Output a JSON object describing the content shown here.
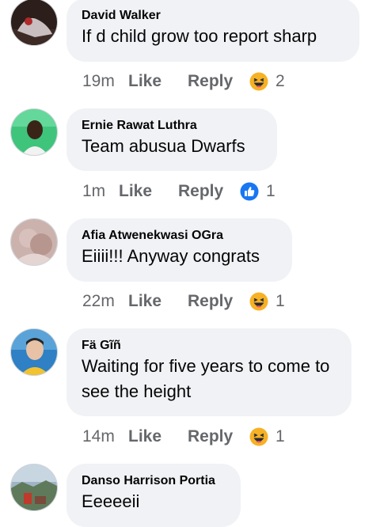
{
  "comments": [
    {
      "name": "David Walker",
      "text": "If d child grow too report sharp",
      "time": "19m",
      "like": "Like",
      "reply": "Reply",
      "reaction": "haha-icon",
      "count": "2"
    },
    {
      "name": "Ernie Rawat Luthra",
      "text": "Team abusua Dwarfs",
      "time": "1m",
      "like": "Like",
      "reply": "Reply",
      "reaction": "like-icon",
      "count": "1"
    },
    {
      "name": "Afia Atwenekwasi OGra",
      "text": "Eiiii!!! Anyway congrats",
      "time": "22m",
      "like": "Like",
      "reply": "Reply",
      "reaction": "haha-icon",
      "count": "1"
    },
    {
      "name": "Fä Gĩñ",
      "text": "Waiting for five years to come to see the height",
      "time": "14m",
      "like": "Like",
      "reply": "Reply",
      "reaction": "haha-icon",
      "count": "1"
    },
    {
      "name": "Danso Harrison Portia",
      "text": "Eeeeeii"
    }
  ],
  "colors": {
    "bubble": "#f0f2f5",
    "meta": "#65676b",
    "like_blue": "#1877f2",
    "haha_yellow": "#f7b125"
  }
}
